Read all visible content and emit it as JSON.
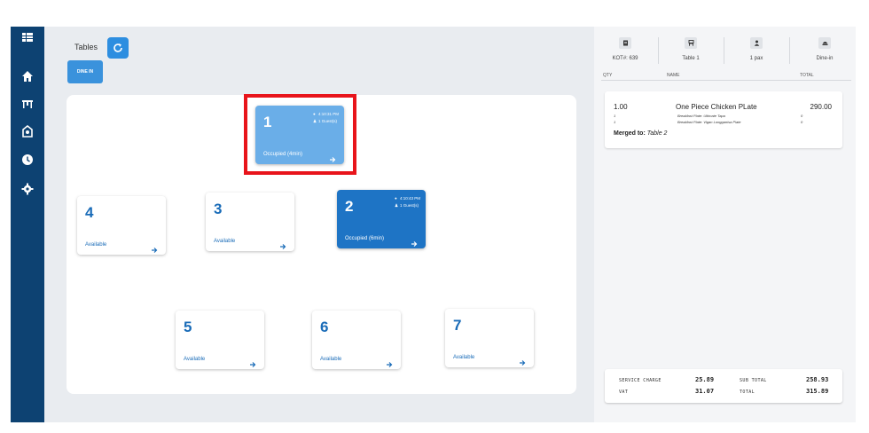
{
  "sidebar": {
    "icons": [
      "menu-grid-icon",
      "home-icon",
      "table-icon",
      "receipt-icon",
      "clock-icon",
      "gear-icon"
    ]
  },
  "header": {
    "title": "Tables",
    "dine_in_label": "DINE IN"
  },
  "tables": [
    {
      "number": "1",
      "status": "Occupied (4min)",
      "time": "4:10:31 PM",
      "guests": "1 Guest(s)"
    },
    {
      "number": "2",
      "status": "Occupied (6min)",
      "time": "4:10:43 PM",
      "guests": "1 Guest(s)"
    },
    {
      "number": "3",
      "status": "Available"
    },
    {
      "number": "4",
      "status": "Available"
    },
    {
      "number": "5",
      "status": "Available"
    },
    {
      "number": "6",
      "status": "Available"
    },
    {
      "number": "7",
      "status": "Available"
    }
  ],
  "order": {
    "info": [
      "KOT#: 639",
      "Table 1",
      "1 pax",
      "Dine-in"
    ],
    "columns": {
      "qty": "QTY",
      "name": "NAME",
      "total": "TOTAL"
    },
    "item": {
      "qty": "1.00",
      "name": "One Piece Chicken PLate",
      "total": "290.00",
      "modifiers": [
        {
          "qty": "1",
          "name": "Breakfast Plate: Ultimate Tapa",
          "price": "0"
        },
        {
          "qty": "1",
          "name": "Breakfast Plate: Vigan Longganisa Plate",
          "price": "0"
        }
      ]
    },
    "merged_label": "Merged to:",
    "merged_value": "Table 2"
  },
  "summary": {
    "service_charge_label": "SERVICE CHARGE",
    "service_charge": "25.89",
    "vat_label": "VAT",
    "vat": "31.07",
    "sub_total_label": "SUB TOTAL",
    "sub_total": "258.93",
    "total_label": "TOTAL",
    "total": "315.89"
  },
  "colors": {
    "sidebar": "#0d4272",
    "accent": "#1e74c5",
    "accent_light": "#6aaee8",
    "highlight": "#e8141b"
  }
}
